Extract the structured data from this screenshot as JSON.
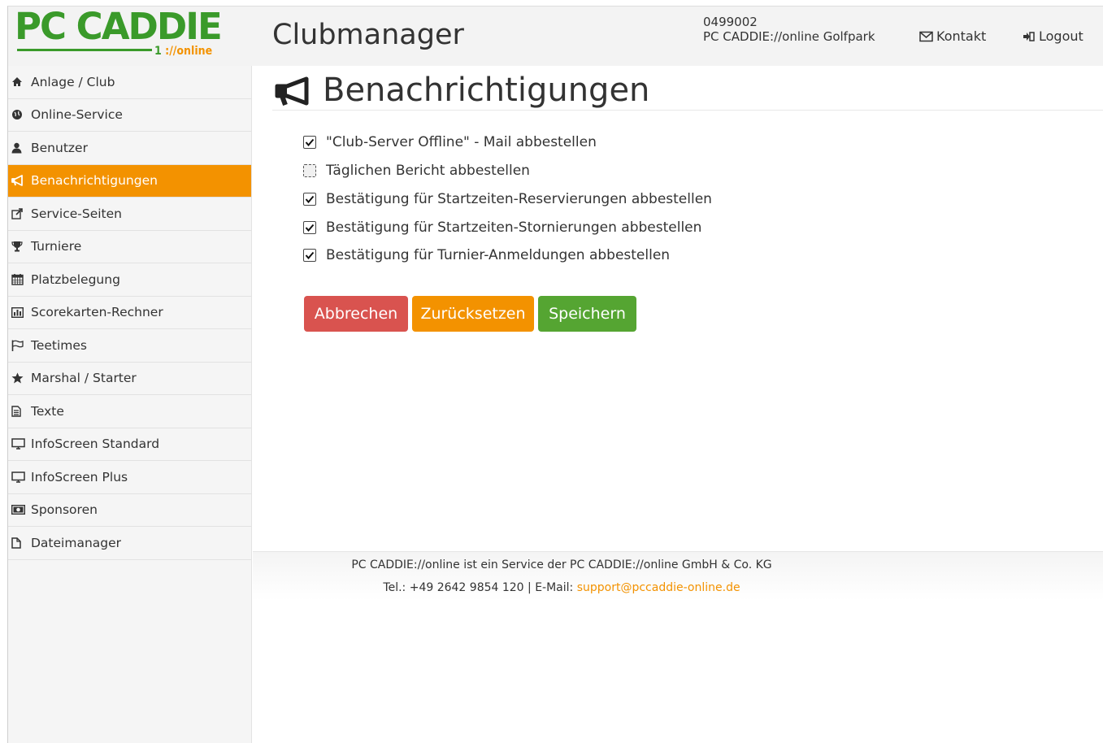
{
  "header": {
    "logo_main": "PC CADDIE",
    "logo_one": "1",
    "logo_sub": "://online",
    "app_title": "Clubmanager",
    "club_id": "0499002",
    "club_name": "PC CADDIE://online Golfpark",
    "contact_label": "Kontakt",
    "logout_label": "Logout"
  },
  "sidebar": {
    "items": [
      {
        "label": "Anlage / Club",
        "icon": "home-icon"
      },
      {
        "label": "Online-Service",
        "icon": "globe-icon"
      },
      {
        "label": "Benutzer",
        "icon": "user-icon"
      },
      {
        "label": "Benachrichtigungen",
        "icon": "bullhorn-icon",
        "active": true
      },
      {
        "label": "Service-Seiten",
        "icon": "external-link-icon"
      },
      {
        "label": "Turniere",
        "icon": "trophy-icon"
      },
      {
        "label": "Platzbelegung",
        "icon": "calendar-icon"
      },
      {
        "label": "Scorekarten-Rechner",
        "icon": "bar-chart-icon"
      },
      {
        "label": "Teetimes",
        "icon": "flag-icon"
      },
      {
        "label": "Marshal / Starter",
        "icon": "star-icon"
      },
      {
        "label": "Texte",
        "icon": "document-icon"
      },
      {
        "label": "InfoScreen Standard",
        "icon": "monitor-icon"
      },
      {
        "label": "InfoScreen Plus",
        "icon": "monitor-icon"
      },
      {
        "label": "Sponsoren",
        "icon": "money-icon"
      },
      {
        "label": "Dateimanager",
        "icon": "file-icon"
      }
    ]
  },
  "main": {
    "title": "Benachrichtigungen",
    "options": [
      {
        "label": "\"Club-Server Offline\" - Mail abbestellen",
        "checked": true
      },
      {
        "label": "Täglichen Bericht abbestellen",
        "checked": false
      },
      {
        "label": "Bestätigung für Startzeiten-Reservierungen abbestellen",
        "checked": true
      },
      {
        "label": "Bestätigung für Startzeiten-Stornierungen abbestellen",
        "checked": true
      },
      {
        "label": "Bestätigung für Turnier-Anmeldungen abbestellen",
        "checked": true
      }
    ],
    "buttons": {
      "cancel": "Abbrechen",
      "reset": "Zurücksetzen",
      "save": "Speichern"
    }
  },
  "footer": {
    "line1": "PC CADDIE://online ist ein Service der PC CADDIE://online GmbH & Co. KG",
    "line2_prefix": "Tel.: +49 2642 9854 120 | E-Mail: ",
    "email": "support@pccaddie-online.de"
  },
  "colors": {
    "brand_green": "#3a9a2a",
    "accent_orange": "#f39200",
    "danger": "#d9534f",
    "warning": "#f0ad4e",
    "success": "#5cb85c"
  }
}
